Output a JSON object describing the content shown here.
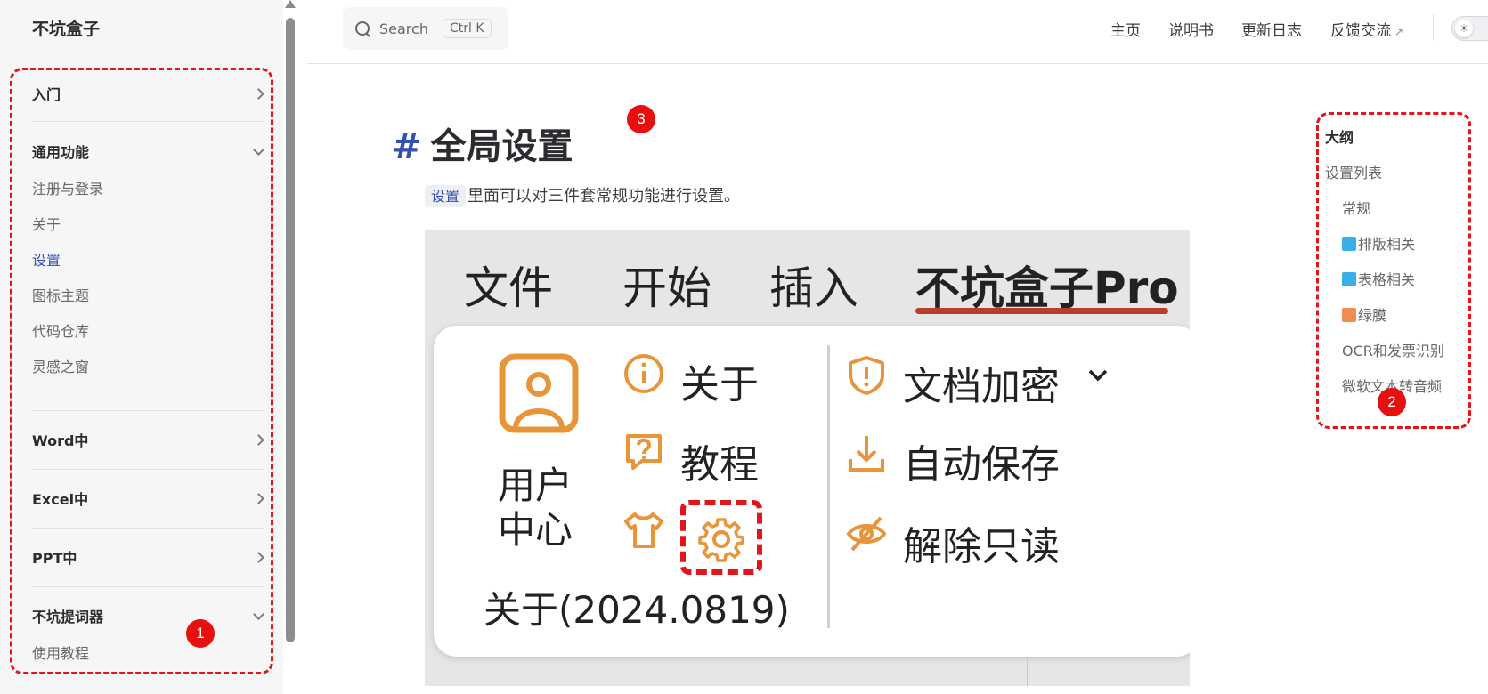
{
  "sidebar": {
    "site_title": "不坑盒子",
    "sections": [
      {
        "label": "入门"
      },
      {
        "label": "通用功能"
      },
      {
        "label": "Word中"
      },
      {
        "label": "Excel中"
      },
      {
        "label": "PPT中"
      },
      {
        "label": "不坑提词器"
      }
    ],
    "general_items": [
      "注册与登录",
      "关于",
      "设置",
      "图标主题",
      "代码仓库",
      "灵感之窗"
    ],
    "prompter_items": [
      "使用教程"
    ]
  },
  "topnav": {
    "search_placeholder": "Search",
    "search_shortcut": "Ctrl K",
    "links": [
      "主页",
      "说明书",
      "更新日志",
      "反馈交流"
    ],
    "external_icon": "↗"
  },
  "content": {
    "hash": "#",
    "title": "全局设置",
    "code_chip": "设置",
    "paragraph": "里面可以对三件套常规功能进行设置。",
    "screenshot": {
      "tabs": [
        "文件",
        "开始",
        "插入",
        "不坑盒子Pro"
      ],
      "user_center": [
        "用户",
        "中心"
      ],
      "about": "关于",
      "tutorial": "教程",
      "version": "关于(2024.0819)",
      "encrypt": "文档加密",
      "autosave": "自动保存",
      "unlock": "解除只读"
    }
  },
  "outline": {
    "title": "大纲",
    "items": [
      {
        "label": "设置列表",
        "level": 1
      },
      {
        "label": "常规",
        "level": 2
      },
      {
        "label": "排版相关",
        "level": 2,
        "marker_color": "#3aaee8"
      },
      {
        "label": "表格相关",
        "level": 2,
        "marker_color": "#3aaee8"
      },
      {
        "label": "绿膜",
        "level": 2,
        "marker_color": "#f28a55"
      },
      {
        "label": "OCR和发票识别",
        "level": 2
      },
      {
        "label": "微软文本转音频",
        "level": 2
      }
    ]
  },
  "badges": [
    "1",
    "2",
    "3"
  ],
  "colors": {
    "accent": "#3451b2",
    "annotation_red": "#e0161c",
    "icon_orange": "#e8953a"
  }
}
